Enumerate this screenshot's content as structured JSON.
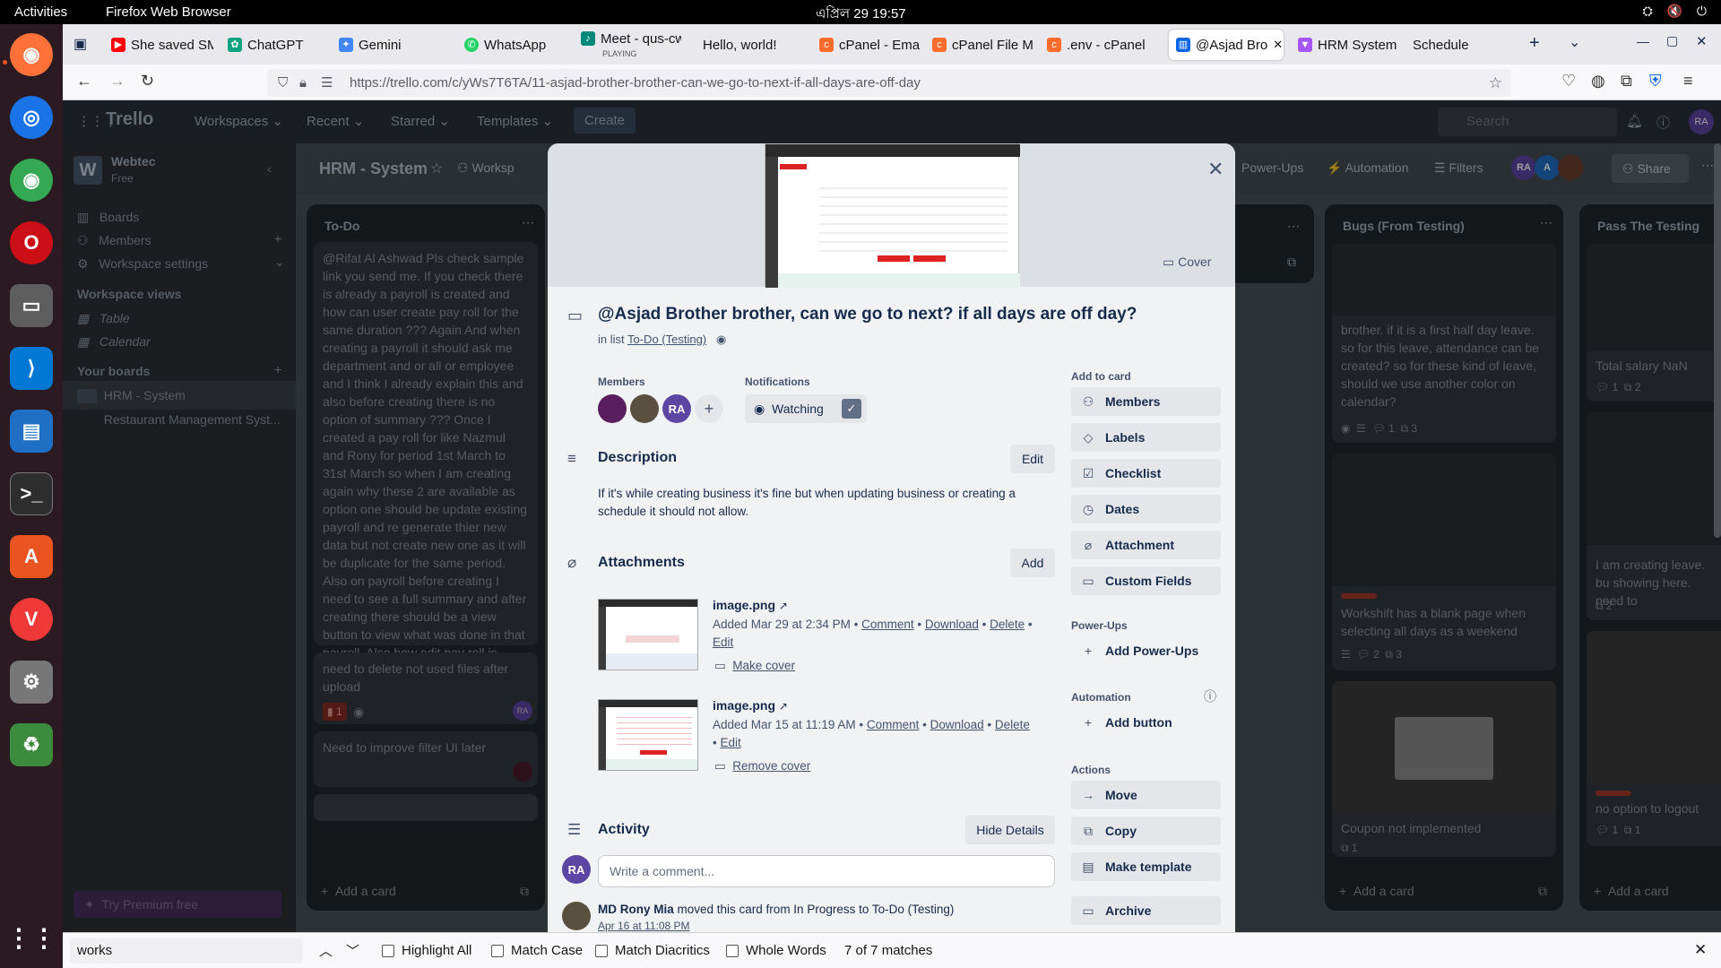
{
  "system": {
    "activities": "Activities",
    "app_name": "Firefox Web Browser",
    "clock": "এপ্রিল 29  19:57"
  },
  "browser": {
    "tabs": [
      {
        "label": "She saved SM",
        "icon": "youtube-icon",
        "color": "#ff0000"
      },
      {
        "label": "ChatGPT",
        "icon": "chatgpt-icon",
        "color": "#10a37f"
      },
      {
        "label": "Gemini",
        "icon": "gemini-icon",
        "color": "#4285f4"
      },
      {
        "label": "WhatsApp",
        "icon": "whatsapp-icon",
        "color": "#25d366"
      },
      {
        "label": "Meet - qus-cw",
        "sub": "PLAYING",
        "icon": "meet-icon",
        "color": "#00897b"
      },
      {
        "label": "Hello, world!",
        "icon": "",
        "color": ""
      },
      {
        "label": "cPanel - Emai",
        "icon": "cpanel-icon",
        "color": "#ff6c2c"
      },
      {
        "label": "cPanel File M",
        "icon": "cpanel-icon",
        "color": "#ff6c2c"
      },
      {
        "label": ".env - cPanel",
        "icon": "cpanel-icon",
        "color": "#ff6c2c"
      },
      {
        "label": "@Asjad Bro",
        "icon": "trello-icon",
        "color": "#0c66e4"
      },
      {
        "label": "HRM System",
        "icon": "vite-icon",
        "color": "#a855f7"
      },
      {
        "label": "Schedule",
        "icon": "",
        "color": ""
      }
    ],
    "url": "https://trello.com/c/yWs7T6TA/11-asjad-brother-brother-can-we-go-to-next-if-all-days-are-off-day"
  },
  "trello_header": {
    "logo": "Trello",
    "menus": [
      "Workspaces",
      "Recent",
      "Starred",
      "Templates"
    ],
    "create": "Create",
    "search_placeholder": "Search"
  },
  "sidebar": {
    "workspace_name": "Webtec",
    "workspace_plan": "Free",
    "items": [
      "Boards",
      "Members",
      "Workspace settings"
    ],
    "views_heading": "Workspace views",
    "views": [
      "Table",
      "Calendar"
    ],
    "boards_heading": "Your boards",
    "boards": [
      "HRM - System",
      "Restaurant Management Syst..."
    ],
    "premium": "Try Premium free"
  },
  "board": {
    "title": "HRM - System",
    "visibility": "Worksp",
    "power_ups": "Power-Ups",
    "automation": "Automation",
    "filters": "Filters",
    "share": "Share",
    "lists": [
      {
        "title": "To-Do",
        "cards": [
          "@Rifat Al Ashwad Pls check sample link you send me. If you check there is already a payroll is created and how can user create pay roll for the same duration ??? Again And when creating a payroll it should ask me department and or all or employee and I think I already explain this and also before creating there is no option of summary ??? Once I created a pay roll for like Nazmul and Rony for period 1st March to 31st March so when I am creating again why these 2 are available as option one should be update existing payroll and re generate thier new data but not create new one as it will be duplicate for the same period. Also on payroll before creating I need to see a full summary and after creating there should be a view button to view what was done in that payroll. Also how edit pay roll is working ???",
          "need to delete not used files after upload",
          "Need to improve filter UI later"
        ],
        "badge": "1",
        "add": "Add a card"
      },
      {
        "title": "Bugs (From Testing)",
        "cards": [
          "brother. if it is a first half day leave. so for this leave, attendance can be created? so for these kind of leave, should we use another color on calendar?",
          "Workshift has a blank page when selecting all days as a weekend",
          "Coupon not implemented"
        ],
        "counts": [
          "1",
          "3",
          "2",
          "3",
          "1"
        ],
        "add": "Add a card"
      },
      {
        "title": "Pass The Testing",
        "cards": [
          "Total salary NaN",
          "I am creating leave. bu showing here. need to",
          "no option to logout"
        ],
        "counts": [
          "1",
          "2",
          "2",
          "1",
          "1"
        ],
        "add": "Add a card"
      }
    ]
  },
  "card_modal": {
    "cover_button": "Cover",
    "title": "@Asjad Brother brother, can we go to next? if all days are off day?",
    "in_list_prefix": "in list ",
    "list_name": "To-Do (Testing)",
    "members_heading": "Members",
    "member_initials": "RA",
    "notifications_heading": "Notifications",
    "watching": "Watching",
    "description_heading": "Description",
    "edit": "Edit",
    "description": "If it's while creating business it's fine but when updating business or creating a schedule it should not allow.",
    "attachments_heading": "Attachments",
    "add": "Add",
    "attachments": [
      {
        "name": "image.png",
        "meta": "Added Mar 29 at 2:34 PM",
        "cover_action": "Make cover"
      },
      {
        "name": "image.png",
        "meta": "Added Mar 15 at 11:19 AM",
        "cover_action": "Remove cover"
      }
    ],
    "attachment_actions": [
      "Comment",
      "Download",
      "Delete",
      "Edit"
    ],
    "activity_heading": "Activity",
    "hide_details": "Hide Details",
    "comment_placeholder": "Write a comment...",
    "activity_user": "MD Rony Mia",
    "activity_text": " moved this card from In Progress to To-Do (Testing)",
    "activity_date": "Apr 16 at 11:08 PM",
    "add_to_card_heading": "Add to card",
    "add_to_card": [
      "Members",
      "Labels",
      "Checklist",
      "Dates",
      "Attachment",
      "Custom Fields"
    ],
    "powerups_heading": "Power-Ups",
    "add_powerups": "Add Power-Ups",
    "automation_heading": "Automation",
    "add_button": "Add button",
    "actions_heading": "Actions",
    "actions": [
      "Move",
      "Copy",
      "Make template",
      "Archive"
    ]
  },
  "findbar": {
    "query": "works",
    "options": [
      "Highlight All",
      "Match Case",
      "Match Diacritics",
      "Whole Words"
    ],
    "matches": "7 of 7 matches"
  }
}
